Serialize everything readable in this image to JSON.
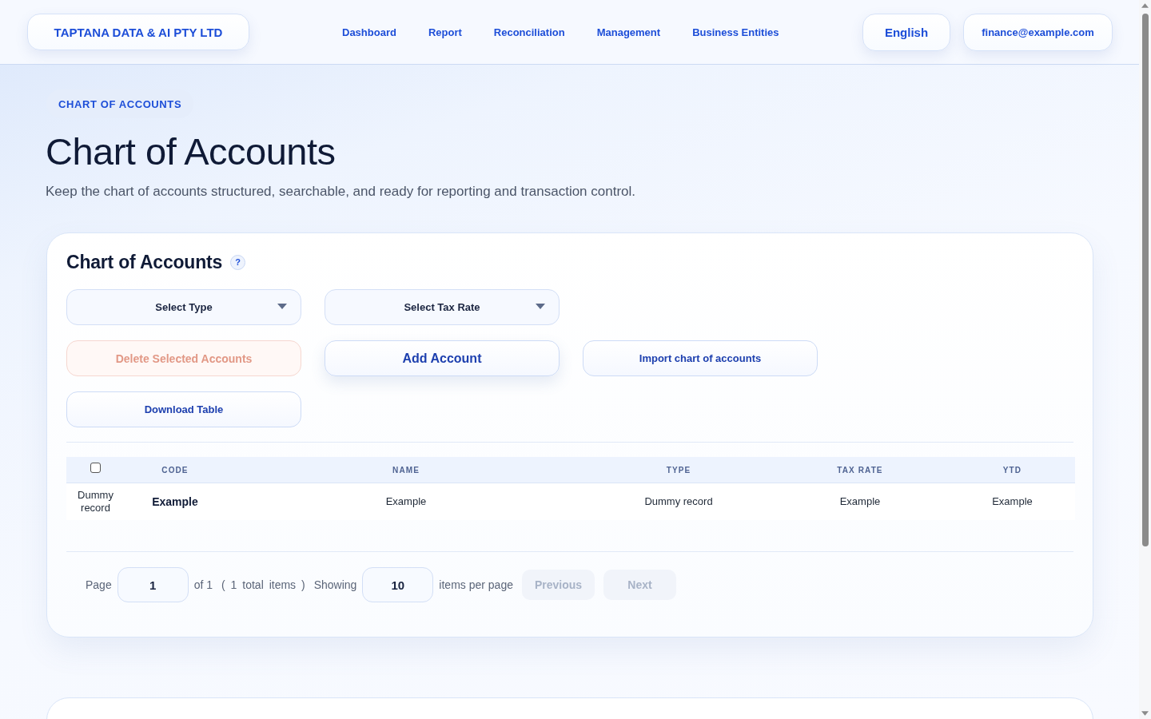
{
  "header": {
    "brand": "TAPTANA DATA & AI PTY LTD",
    "nav": [
      {
        "label": "Dashboard"
      },
      {
        "label": "Report"
      },
      {
        "label": "Reconciliation"
      },
      {
        "label": "Management"
      },
      {
        "label": "Business Entities"
      }
    ],
    "language": "English",
    "account": "finance@example.com"
  },
  "hero": {
    "badge": "CHART OF ACCOUNTS",
    "title": "Chart of Accounts",
    "subtitle": "Keep the chart of accounts structured, searchable, and ready for reporting and transaction control."
  },
  "card": {
    "title": "Chart of Accounts",
    "help": "?",
    "filters": [
      {
        "label": "Select Type"
      },
      {
        "label": "Select Tax Rate"
      }
    ],
    "actions": [
      {
        "label": "Delete Selected Accounts",
        "kind": "danger",
        "disabled": true
      },
      {
        "label": "Add Account",
        "kind": "primary",
        "disabled": false
      },
      {
        "label": "Import chart of accounts",
        "kind": "secondary",
        "disabled": false
      },
      {
        "label": "Download Table",
        "kind": "secondary",
        "disabled": false
      }
    ],
    "table": {
      "columns": [
        {
          "kind": "checkbox",
          "checked": false
        },
        {
          "kind": "text",
          "label": "CODE"
        },
        {
          "kind": "text",
          "label": "NAME"
        },
        {
          "kind": "text",
          "label": "TYPE"
        },
        {
          "kind": "text",
          "label": "TAX RATE"
        },
        {
          "kind": "text",
          "label": "YTD"
        }
      ],
      "rows": [
        {
          "cells": [
            "Dummy record",
            "Example",
            "Example",
            "Dummy record",
            "Example",
            "Example"
          ]
        }
      ]
    },
    "pagination": {
      "page_label": "Page",
      "page": "1",
      "of": "of 1",
      "total": "( 1 total items )",
      "showing": "Showing",
      "per_page": "10",
      "per_page_label": "items per page",
      "buttons": [
        {
          "label": "Previous",
          "disabled": true
        },
        {
          "label": "Next",
          "disabled": true
        }
      ]
    }
  }
}
